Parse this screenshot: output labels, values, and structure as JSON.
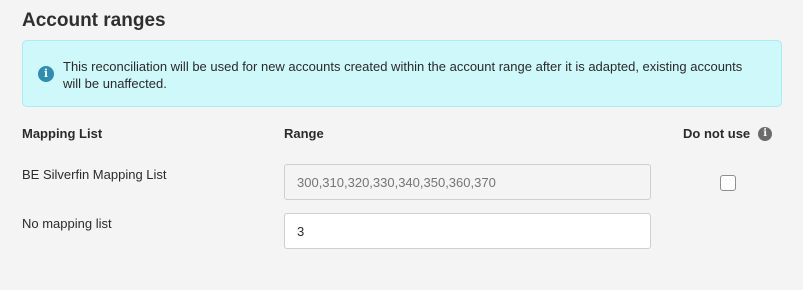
{
  "section": {
    "title": "Account ranges"
  },
  "info": {
    "icon": "info-icon",
    "text": "This reconciliation will be used for new accounts created within the account range after it is adapted, existing accounts will be unaffected."
  },
  "columns": {
    "mapping_list": "Mapping List",
    "range": "Range",
    "do_not_use": "Do not use",
    "do_not_use_icon": "info-icon"
  },
  "rows": [
    {
      "label": "BE Silverfin Mapping List",
      "range_placeholder": "300,310,320,330,340,350,360,370",
      "range_value": "",
      "disabled": true,
      "do_not_use_checked": false
    },
    {
      "label": "No mapping list",
      "range_placeholder": "",
      "range_value": "3",
      "disabled": false
    }
  ],
  "colors": {
    "info_bg": "#cff8fa",
    "info_icon": "#2d8eb0"
  }
}
